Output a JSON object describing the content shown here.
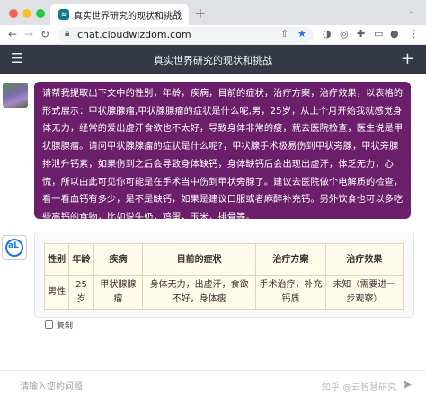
{
  "browser": {
    "tab_title": "真实世界研究的现状和挑战",
    "tab_icon": "site-favicon",
    "url": "chat.cloudwizdom.com"
  },
  "app": {
    "title": "真实世界研究的现状和挑战"
  },
  "user_message": {
    "text": "请帮我提取出下文中的性别，年龄，疾病，目前的症状，治疗方案，治疗效果，以表格的形式展示：甲状腺腺瘤,甲状腺腺瘤的症状是什么呢,男，25岁，从上个月开始我就感觉身体无力，经常的爱出虚汗食欲也不太好，导致身体非常的瘦，就去医院检查，医生说是甲状腺腺瘤。请问甲状腺腺瘤的症状是什么呢?，甲状腺手术极易伤到甲状旁腺，甲状旁腺排泄升钙素，如果伤到之后会导致身体缺钙，身体缺钙后会出现出虚汗，体乏无力，心慌，所以由此可见你可能是在手术当中伤到甲状旁腺了。建议去医院做个电解质的检查，看一看血钙有多少，是不是缺钙，如果是建议口服或者麻醉补充钙。另外饮食也可以多吃些高钙的食物，比如说牛奶，鸡蛋，玉米，排骨等。"
  },
  "bot_table": {
    "headers": [
      "性别",
      "年龄",
      "疾病",
      "目前的症状",
      "治疗方案",
      "治疗效果"
    ],
    "row": [
      "男性",
      "25岁",
      "甲状腺腺瘤",
      "身体无力，出虚汗，食欲不好，身体瘦",
      "手术治疗，补充钙质",
      "未知（需要进一步观察）"
    ]
  },
  "copy_label": "复制",
  "input": {
    "placeholder": "请输入您的问题"
  },
  "watermark": "知乎 @云智慧研究"
}
